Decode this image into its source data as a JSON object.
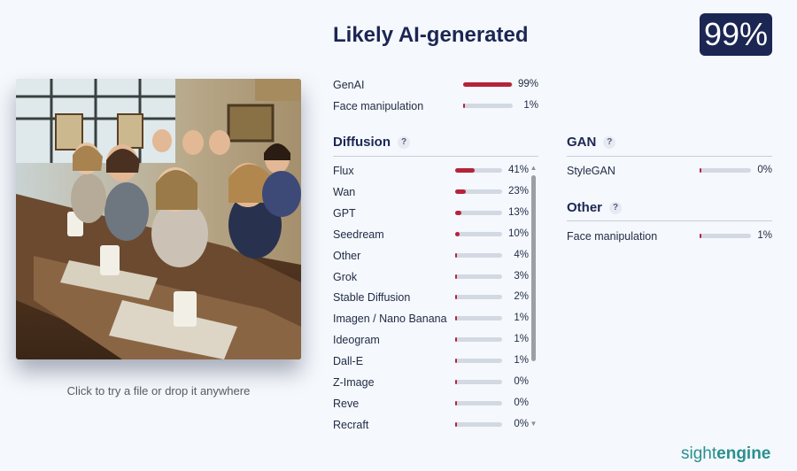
{
  "result": {
    "headline": "Likely AI-generated",
    "score": "99%"
  },
  "upload": {
    "hint": "Click to try a file or drop it anywhere"
  },
  "summary": [
    {
      "label": "GenAI",
      "value": 99,
      "pct": "99%"
    },
    {
      "label": "Face manipulation",
      "value": 1,
      "pct": "1%"
    }
  ],
  "diffusion": {
    "title": "Diffusion",
    "help": "?",
    "items": [
      {
        "label": "Flux",
        "value": 41,
        "pct": "41%"
      },
      {
        "label": "Wan",
        "value": 23,
        "pct": "23%"
      },
      {
        "label": "GPT",
        "value": 13,
        "pct": "13%"
      },
      {
        "label": "Seedream",
        "value": 10,
        "pct": "10%"
      },
      {
        "label": "Other",
        "value": 4,
        "pct": "4%"
      },
      {
        "label": "Grok",
        "value": 3,
        "pct": "3%"
      },
      {
        "label": "Stable Diffusion",
        "value": 2,
        "pct": "2%"
      },
      {
        "label": "Imagen / Nano Banana",
        "value": 1,
        "pct": "1%"
      },
      {
        "label": "Ideogram",
        "value": 1,
        "pct": "1%"
      },
      {
        "label": "Dall-E",
        "value": 1,
        "pct": "1%"
      },
      {
        "label": "Z-Image",
        "value": 0,
        "pct": "0%"
      },
      {
        "label": "Reve",
        "value": 0,
        "pct": "0%"
      },
      {
        "label": "Recraft",
        "value": 0,
        "pct": "0%"
      }
    ]
  },
  "gan": {
    "title": "GAN",
    "help": "?",
    "items": [
      {
        "label": "StyleGAN",
        "value": 0,
        "pct": "0%"
      }
    ]
  },
  "other": {
    "title": "Other",
    "help": "?",
    "items": [
      {
        "label": "Face manipulation",
        "value": 1,
        "pct": "1%"
      }
    ]
  },
  "brand": {
    "part1": "sight",
    "part2": "engine"
  },
  "colors": {
    "accent": "#b5233b",
    "navy": "#1c2653",
    "brand": "#2a8f8f"
  }
}
